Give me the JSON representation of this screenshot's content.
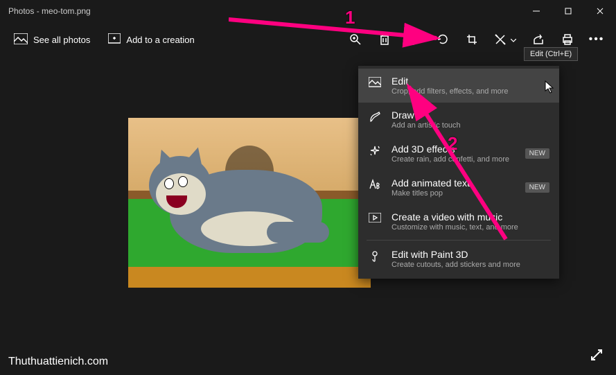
{
  "window": {
    "title": "Photos - meo-tom.png"
  },
  "toolbar": {
    "see_all": "See all photos",
    "add_creation": "Add to a creation"
  },
  "tooltip": "Edit (Ctrl+E)",
  "menu": {
    "items": [
      {
        "title": "Edit",
        "desc": "Crop, add filters, effects, and more",
        "badge": ""
      },
      {
        "title": "Draw",
        "desc": "Add an artistic touch",
        "badge": ""
      },
      {
        "title": "Add 3D effects",
        "desc": "Create rain, add confetti, and more",
        "badge": "NEW"
      },
      {
        "title": "Add animated text",
        "desc": "Make titles pop",
        "badge": "NEW"
      },
      {
        "title": "Create a video with music",
        "desc": "Customize with music, text, and more",
        "badge": ""
      },
      {
        "title": "Edit with Paint 3D",
        "desc": "Create cutouts, add stickers and more",
        "badge": ""
      }
    ]
  },
  "annotation": {
    "one": "1",
    "two": "2"
  },
  "watermark": "Thuthuattienich.com"
}
